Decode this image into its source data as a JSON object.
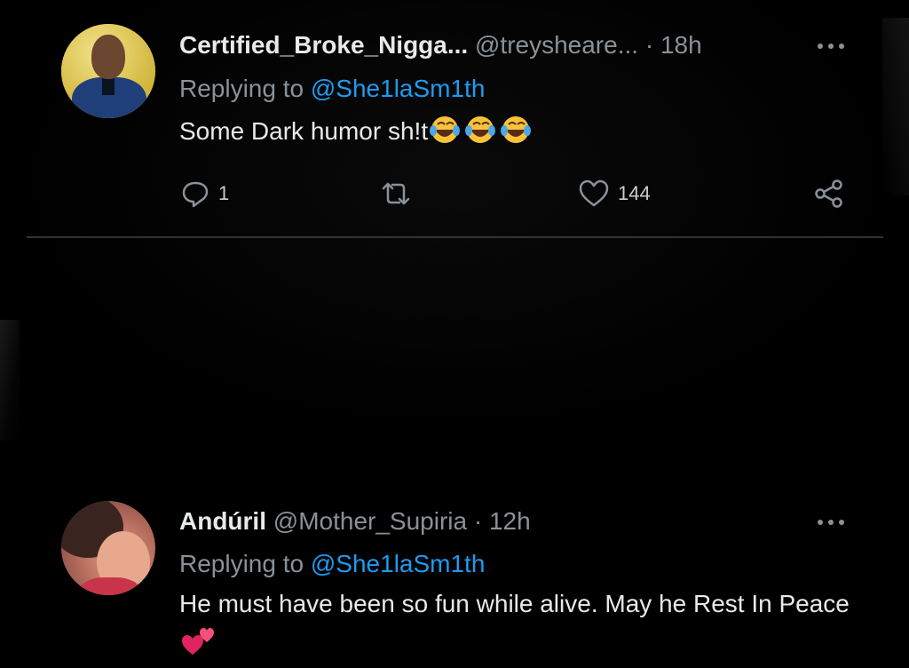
{
  "tweets": [
    {
      "author_name": "Certified_Broke_Nigga...",
      "handle": "@treysheare...",
      "separator": "·",
      "time": "18h",
      "replying_prefix": "Replying to ",
      "replying_to": "@She1laSm1th",
      "text": "Some Dark humor sh!t",
      "emoji": "face-with-tears-of-joy x3",
      "reply_count": "1",
      "like_count": "144"
    },
    {
      "author_name": "Andúril",
      "handle": "@Mother_Supiria",
      "separator": "·",
      "time": "12h",
      "replying_prefix": "Replying to ",
      "replying_to": "@She1laSm1th",
      "text": "He must have been so fun while alive. May he Rest In Peace",
      "emoji": "two-hearts"
    }
  ],
  "colors": {
    "background": "#000000",
    "text": "#e7e9ea",
    "muted": "#8b9197",
    "link": "#1d9bf0",
    "divider": "#2f3336"
  }
}
